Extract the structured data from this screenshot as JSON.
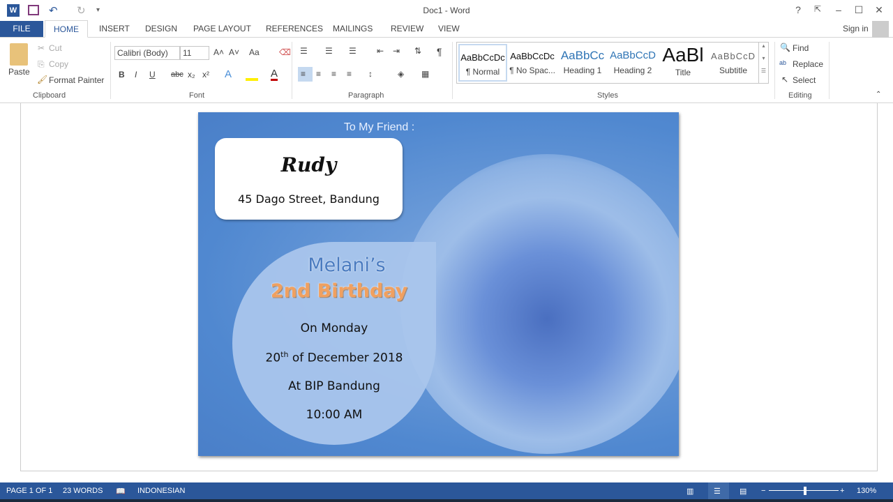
{
  "window": {
    "title": "Doc1 - Word",
    "help": "?",
    "minimize": "–",
    "maximize": "☐",
    "close": "✕",
    "restore": "⇱"
  },
  "quick_access": {
    "undo": "↶",
    "redo": "↻",
    "more": "▾"
  },
  "tabs": {
    "file": "FILE",
    "items": [
      "HOME",
      "INSERT",
      "DESIGN",
      "PAGE LAYOUT",
      "REFERENCES",
      "MAILINGS",
      "REVIEW",
      "VIEW"
    ],
    "sign_in": "Sign in"
  },
  "clipboard": {
    "paste": "Paste",
    "cut": "Cut",
    "copy": "Copy",
    "format_painter": "Format Painter",
    "group": "Clipboard"
  },
  "font": {
    "name": "Calibri (Body)",
    "size": "11",
    "group": "Font",
    "bold": "B",
    "italic": "I",
    "underline": "U",
    "strike": "abc",
    "sub": "x₂",
    "sup": "x²",
    "grow": "A˄",
    "shrink": "A˅",
    "case": "Aa"
  },
  "paragraph": {
    "group": "Paragraph",
    "pilcrow": "¶"
  },
  "styles": {
    "group": "Styles",
    "items": [
      {
        "preview": "AaBbCcDc",
        "label": "¶ Normal"
      },
      {
        "preview": "AaBbCcDc",
        "label": "¶ No Spac..."
      },
      {
        "preview": "AaBbCc",
        "label": "Heading 1"
      },
      {
        "preview": "AaBbCcD",
        "label": "Heading 2"
      },
      {
        "preview": "AaBl",
        "label": "Title"
      },
      {
        "preview": "AaBbCcD",
        "label": "Subtitle"
      }
    ]
  },
  "editing": {
    "group": "Editing",
    "find": "Find",
    "replace": "Replace",
    "select": "Select"
  },
  "card": {
    "to": "To My Friend :",
    "name": "Rudy",
    "address": "45 Dago Street, Bandung",
    "title1": "Melani’s",
    "title2": "2nd Birthday",
    "day": "On Monday",
    "date_num": "20",
    "date_sup": "th",
    "date_rest": " of December 2018",
    "place": "At BIP Bandung",
    "time": "10:00 AM"
  },
  "status": {
    "page": "PAGE 1 OF 1",
    "words": "23 WORDS",
    "language": "INDONESIAN",
    "zoom": "130%",
    "zoom_percent": 130
  },
  "colors": {
    "accent": "#2b579a",
    "card_blue": "#5088d0",
    "title_orange": "#f0a060"
  }
}
